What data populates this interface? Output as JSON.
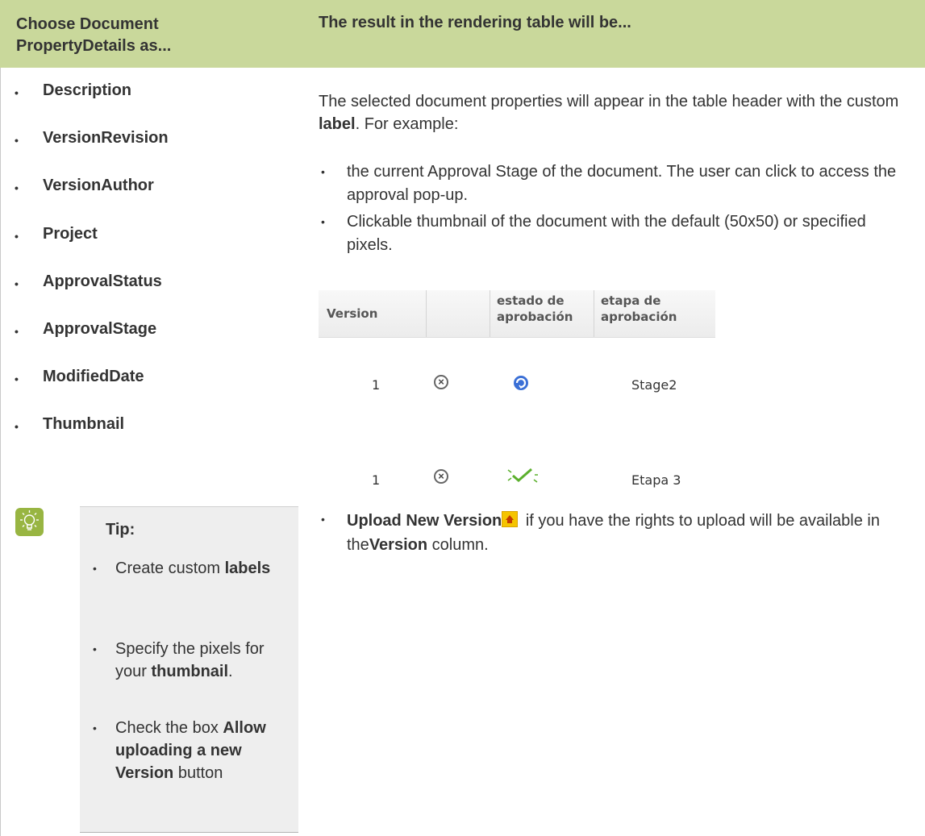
{
  "header": {
    "left": "Choose Document PropertyDetails as...",
    "right": "The result in the rendering table will be..."
  },
  "properties": [
    "Description",
    "VersionRevision",
    "VersionAuthor",
    "Project",
    "ApprovalStatus",
    "ApprovalStage",
    "ModifiedDate",
    "Thumbnail"
  ],
  "tip": {
    "title": "Tip:",
    "items": [
      {
        "text": "Create custom ",
        "bold": "labels",
        "after": ""
      },
      {
        "text": "Specify the pixels for your ",
        "bold": "thumbnail",
        "after": "."
      },
      {
        "text": "Check the box ",
        "bold": "Allow uploading a new Version",
        "after": " button"
      }
    ]
  },
  "result": {
    "intro_before": "The selected document properties will appear in the table header with the custom ",
    "intro_bold": "label",
    "intro_after": ". For example:",
    "bullets": [
      "the current Approval Stage of the document. The user can click to access the approval pop-up.",
      "Clickable thumbnail of the document with the default (50x50) or specified pixels."
    ],
    "table": {
      "headers": [
        "Version",
        "",
        "estado de aprobación",
        "etapa de aprobación"
      ],
      "rows": [
        {
          "version": "1",
          "stage": "Stage2"
        },
        {
          "version": "1",
          "stage": "Etapa 3"
        }
      ]
    },
    "upload_bold": "Upload New Version",
    "upload_text1": " if you have the rights to upload will be available in the",
    "upload_bold2": "Version",
    "upload_text2": " column."
  },
  "colors": {
    "header_bg": "#c9d89b",
    "tip_bg": "#eeeeee",
    "tip_icon": "#98b542",
    "approve_blue": "#3a6fd6",
    "approve_green": "#5bb02d"
  }
}
